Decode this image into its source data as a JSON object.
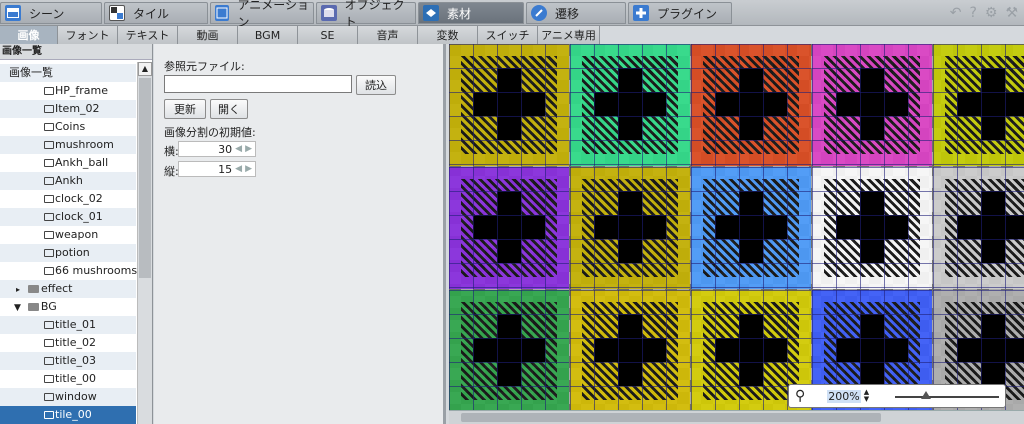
{
  "top_tabs": [
    {
      "label": "シーン",
      "icon": "scene-icon"
    },
    {
      "label": "タイル",
      "icon": "tile-icon"
    },
    {
      "label": "アニメーション",
      "icon": "animation-icon"
    },
    {
      "label": "オブジェクト",
      "icon": "object-icon"
    },
    {
      "label": "素材",
      "icon": "material-icon"
    },
    {
      "label": "遷移",
      "icon": "transition-icon"
    },
    {
      "label": "プラグイン",
      "icon": "plugin-icon"
    }
  ],
  "active_top_tab": "素材",
  "sub_tabs": [
    "画像",
    "フォント",
    "テキスト",
    "動画",
    "BGM",
    "SE",
    "音声",
    "変数",
    "スイッチ",
    "アニメ専用"
  ],
  "active_sub_tab": "画像",
  "left_panel": {
    "title": "画像一覧",
    "tree": [
      {
        "label": "画像一覧",
        "kind": "root"
      },
      {
        "label": "HP_frame",
        "kind": "file"
      },
      {
        "label": "Item_02",
        "kind": "file"
      },
      {
        "label": "Coins",
        "kind": "file"
      },
      {
        "label": "mushroom",
        "kind": "file"
      },
      {
        "label": "Ankh_ball",
        "kind": "file"
      },
      {
        "label": "Ankh",
        "kind": "file"
      },
      {
        "label": "clock_02",
        "kind": "file"
      },
      {
        "label": "clock_01",
        "kind": "file"
      },
      {
        "label": "weapon",
        "kind": "file"
      },
      {
        "label": "potion",
        "kind": "file"
      },
      {
        "label": "66 mushrooms",
        "kind": "file"
      },
      {
        "label": "effect",
        "kind": "folder-collapsed"
      },
      {
        "label": "BG",
        "kind": "folder-expanded"
      },
      {
        "label": "title_01",
        "kind": "file"
      },
      {
        "label": "title_02",
        "kind": "file"
      },
      {
        "label": "title_03",
        "kind": "file"
      },
      {
        "label": "title_00",
        "kind": "file"
      },
      {
        "label": "window",
        "kind": "file"
      },
      {
        "label": "tile_00",
        "kind": "file",
        "selected": true
      }
    ]
  },
  "properties": {
    "ref_file_label": "参照元ファイル:",
    "ref_file_value": "",
    "load_button": "読込",
    "update_button": "更新",
    "open_button": "開く",
    "split_label": "画像分割の初期値:",
    "h_label": "横:",
    "h_value": "30",
    "v_label": "縦:",
    "v_value": "15"
  },
  "zoom": {
    "value": "200",
    "unit": "%"
  },
  "tile_colors": [
    "#c8b400",
    "#2ee08a",
    "#e04a1e",
    "#e040c8",
    "#c8d000",
    "#8a2be2",
    "#c8b400",
    "#4a9cff",
    "#ffffff",
    "#d0d0d0",
    "#2ea84a",
    "#d8c000",
    "#d8d000",
    "#3a5cff",
    "#b0b0b0"
  ]
}
